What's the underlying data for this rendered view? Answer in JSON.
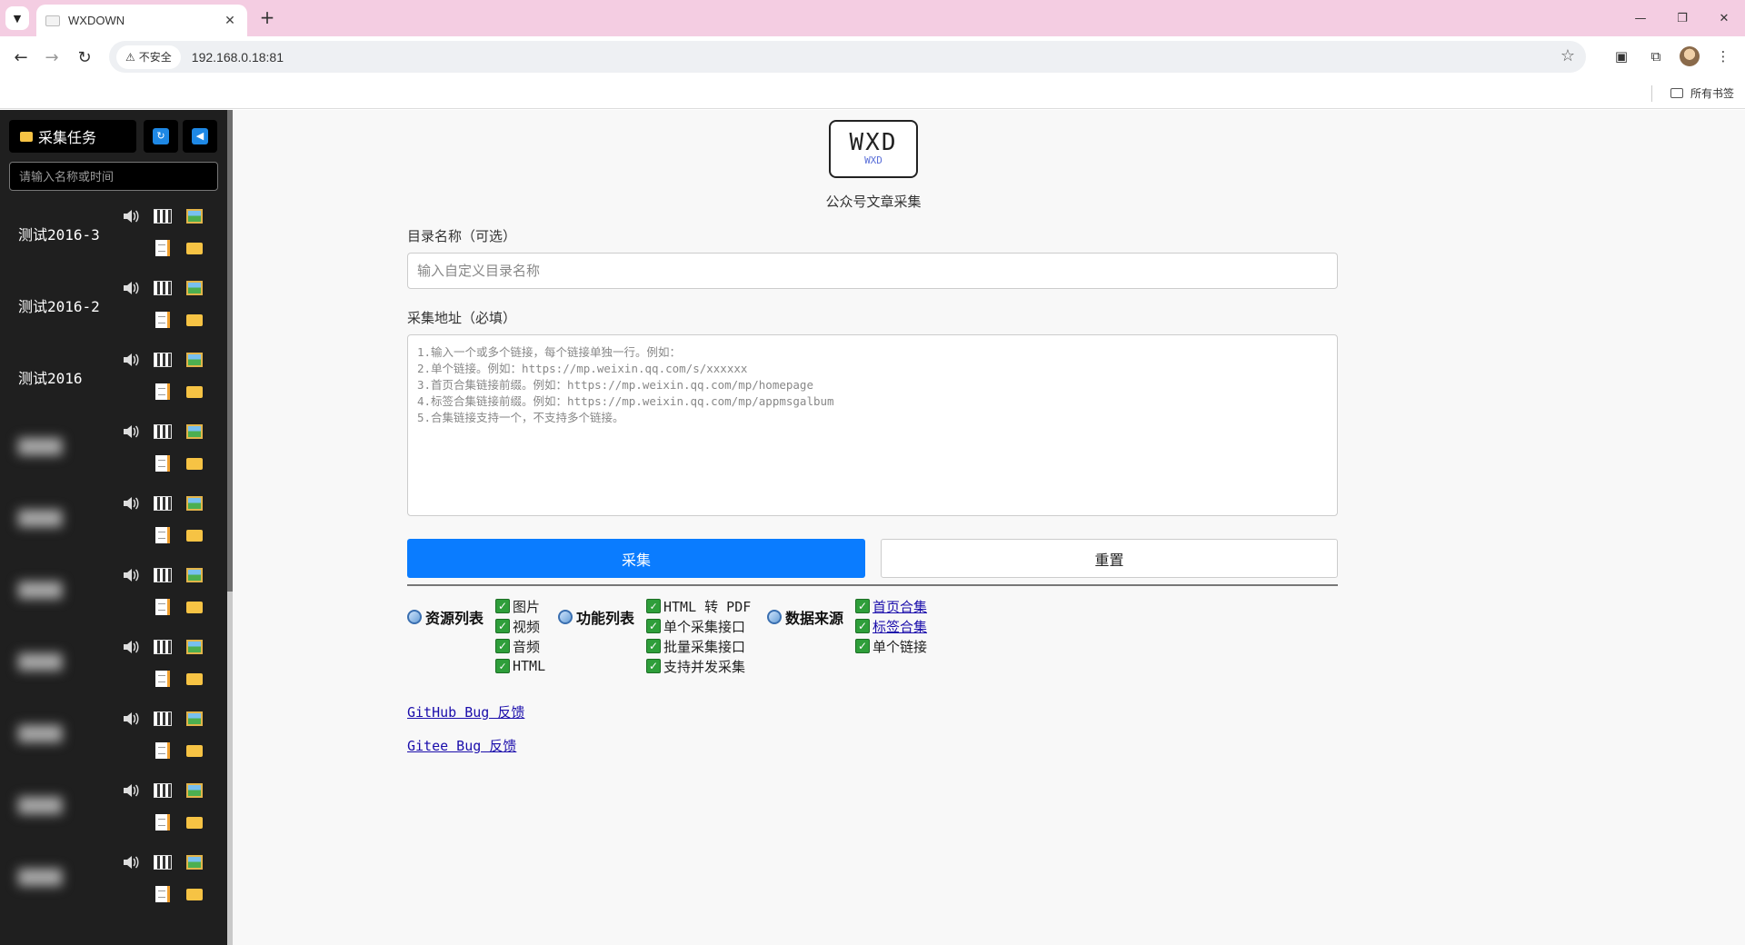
{
  "browser": {
    "tab_title": "WXDOWN",
    "insecure_label": "不安全",
    "url": "192.168.0.18:81",
    "bookmarks_all": "所有书签"
  },
  "sidebar": {
    "title": "采集任务",
    "search_placeholder": "请输入名称或时间",
    "tasks": [
      {
        "name": "测试2016-3"
      },
      {
        "name": "测试2016-2"
      },
      {
        "name": "测试2016"
      }
    ]
  },
  "main": {
    "logo_text": "WXD",
    "logo_subtext": "WXD",
    "app_title": "公众号文章采集",
    "dir_label": "目录名称（可选）",
    "dir_placeholder": "输入自定义目录名称",
    "url_label": "采集地址（必填）",
    "url_placeholder_lines": [
      "1.输入一个或多个链接，每个链接单独一行。例如：",
      "2.单个链接。例如：https://mp.weixin.qq.com/s/xxxxxx",
      "3.首页合集链接前缀。例如：https://mp.weixin.qq.com/mp/homepage",
      "4.标签合集链接前缀。例如：https://mp.weixin.qq.com/mp/appmsgalbum",
      "5.合集链接支持一个，不支持多个链接。"
    ],
    "collect_button": "采集",
    "reset_button": "重置",
    "groups": {
      "resources": {
        "title": "资源列表",
        "items": [
          "图片",
          "视频",
          "音频",
          "HTML"
        ]
      },
      "features": {
        "title": "功能列表",
        "items": [
          "HTML 转 PDF",
          "单个采集接口",
          "批量采集接口",
          "支持并发采集"
        ]
      },
      "sources": {
        "title": "数据来源",
        "items": [
          "首页合集",
          "标签合集",
          "单个链接"
        ]
      }
    },
    "links": {
      "github": "GitHub Bug 反馈",
      "gitee": "Gitee Bug 反馈"
    }
  }
}
